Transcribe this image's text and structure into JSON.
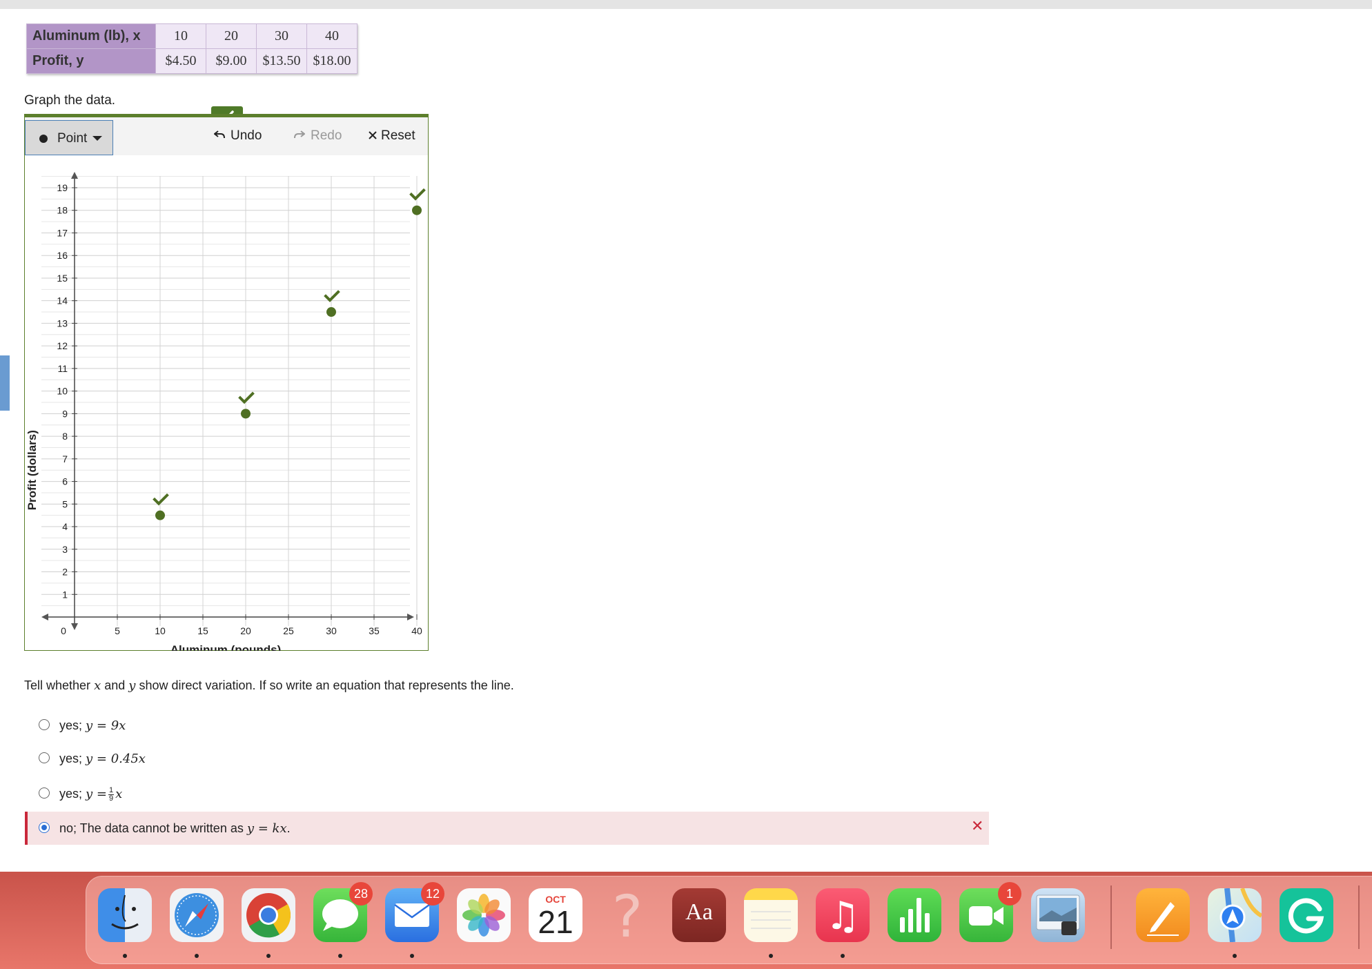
{
  "table": {
    "x_header": "Aluminum (lb), x",
    "y_header": "Profit, y",
    "x_values": [
      "10",
      "20",
      "30",
      "40"
    ],
    "y_values": [
      "$4.50",
      "$9.00",
      "$13.50",
      "$18.00"
    ]
  },
  "instruction": "Graph the data.",
  "toolbar": {
    "point_label": "Point",
    "undo_label": "Undo",
    "redo_label": "Redo",
    "reset_label": "Reset"
  },
  "chart_data": {
    "type": "scatter",
    "xlabel": "Aluminum (pounds)",
    "ylabel": "Profit (dollars)",
    "xlim": [
      0,
      40
    ],
    "ylim": [
      0,
      19
    ],
    "x_ticks": [
      0,
      5,
      10,
      15,
      20,
      25,
      30,
      35,
      40
    ],
    "y_ticks": [
      1,
      2,
      3,
      4,
      5,
      6,
      7,
      8,
      9,
      10,
      11,
      12,
      13,
      14,
      15,
      16,
      17,
      18,
      19
    ],
    "grid": true,
    "points": [
      {
        "x": 10,
        "y": 4.5
      },
      {
        "x": 20,
        "y": 9
      },
      {
        "x": 30,
        "y": 13.5
      },
      {
        "x": 40,
        "y": 18
      }
    ],
    "point_color": "#4f6f23"
  },
  "question": {
    "prefix": "Tell whether ",
    "var_x": "x",
    "and": " and ",
    "var_y": "y",
    "suffix": " show direct variation. If so write an equation that represents the line."
  },
  "options": [
    {
      "prefix": "yes; ",
      "math": "y = 9x",
      "selected": false
    },
    {
      "prefix": "yes; ",
      "math": "y = 0.45x",
      "selected": false
    },
    {
      "prefix": "yes; ",
      "math_lhs": "y =",
      "frac_num": "1",
      "frac_den": "9",
      "math_rhs": "x",
      "selected": false
    },
    {
      "prefix": "no; The data cannot be written as ",
      "math": "y = kx",
      "suffix": ".",
      "selected": true
    }
  ],
  "dock": {
    "badges": {
      "messages": "28",
      "mail": "12",
      "facetime": "1"
    },
    "calendar_month": "OCT",
    "calendar_day": "21",
    "dictionary_label": "Aa"
  }
}
